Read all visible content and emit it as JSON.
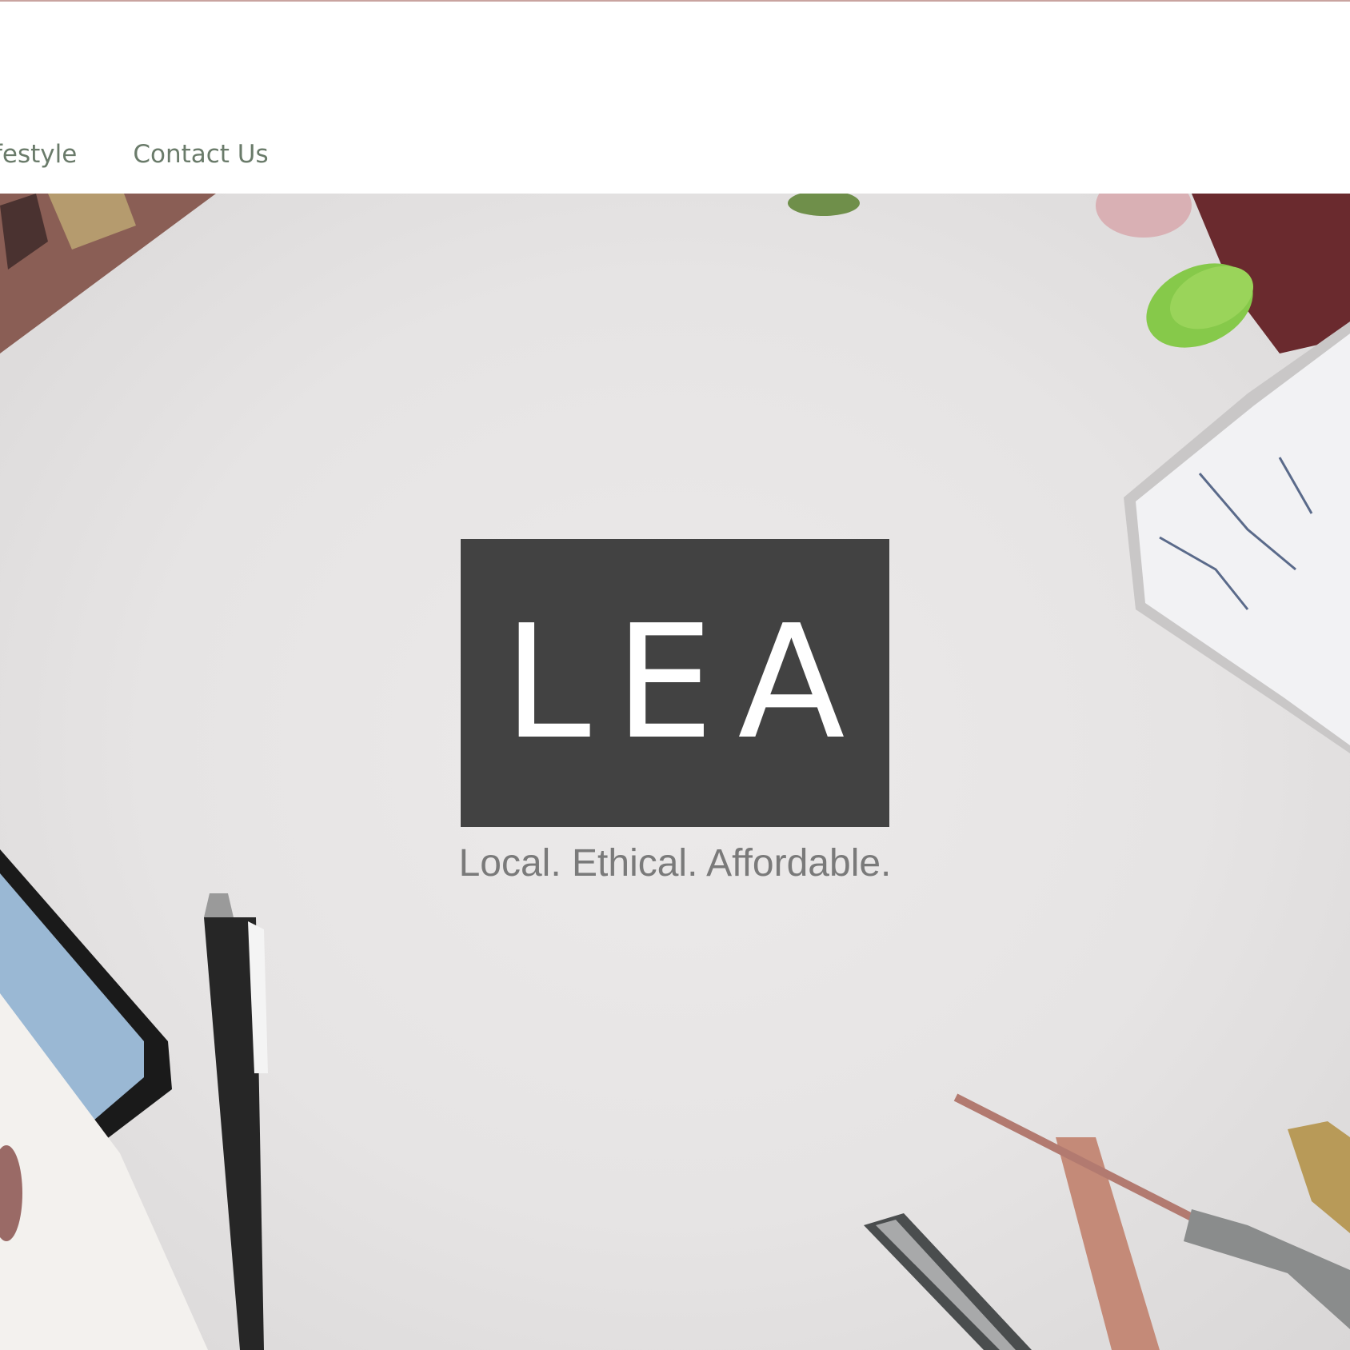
{
  "nav": {
    "items": [
      {
        "label": "festyle"
      },
      {
        "label": "Contact Us"
      }
    ]
  },
  "hero": {
    "logo_text": "LEA",
    "tagline": "Local. Ethical. Affordable."
  },
  "colors": {
    "nav_text": "#6a7b6a",
    "logo_box": "#424242",
    "logo_text": "#ffffff",
    "tagline": "#7a7a7a",
    "top_rule": "#c9a4a0"
  }
}
